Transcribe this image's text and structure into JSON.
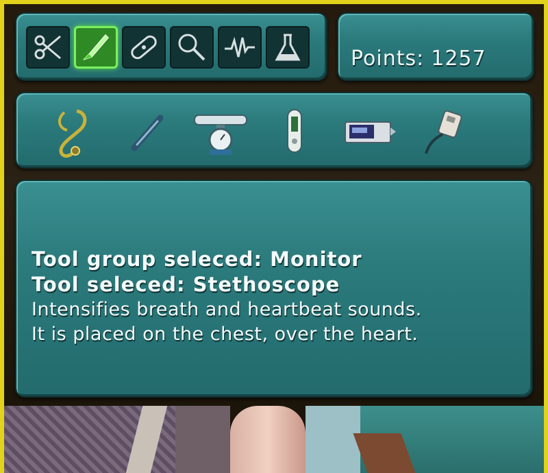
{
  "tool_groups": [
    {
      "name": "scissors",
      "icon": "scissors-icon",
      "selected": false
    },
    {
      "name": "scalpel",
      "icon": "scalpel-icon",
      "selected": true
    },
    {
      "name": "bandage",
      "icon": "bandage-icon",
      "selected": false
    },
    {
      "name": "magnifier",
      "icon": "magnifier-icon",
      "selected": false
    },
    {
      "name": "heartbeat",
      "icon": "heartbeat-icon",
      "selected": false
    },
    {
      "name": "flask",
      "icon": "flask-icon",
      "selected": false
    }
  ],
  "points": {
    "label": "Points:",
    "value": "1257"
  },
  "tools": [
    {
      "icon": "stethoscope-icon"
    },
    {
      "icon": "thermometer-icon"
    },
    {
      "icon": "scale-icon"
    },
    {
      "icon": "pulse-oximeter-icon"
    },
    {
      "icon": "blood-pressure-monitor-icon"
    },
    {
      "icon": "ecg-device-icon"
    }
  ],
  "info": {
    "group_line": "Tool group seleced: Monitor",
    "tool_line": "Tool seleced: Stethoscope",
    "desc_line1": "Intensifies breath and heartbeat sounds.",
    "desc_line2": "It is placed on the chest, over the heart."
  },
  "colors": {
    "panel": "#2b7a7c",
    "frame": "#e3d21c",
    "selected": "#2f8a25",
    "selected_glow": "#7cf060"
  }
}
